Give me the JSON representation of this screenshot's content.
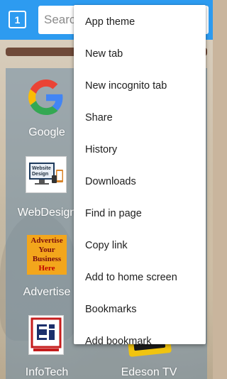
{
  "toolbar": {
    "tab_count": "1",
    "search_placeholder": "Search"
  },
  "shortcuts": [
    {
      "label": "Google"
    },
    {
      "label": "WebDesign"
    },
    {
      "label": "Advertise"
    },
    {
      "label": "InfoTech"
    },
    {
      "label": "Edeson TV"
    }
  ],
  "webdesign_thumb": {
    "text_line1": "Website",
    "text_line2": "Design"
  },
  "advertise_thumb": {
    "line1": "Advertise",
    "line2": "Your",
    "line3": "Business",
    "line4": "Here"
  },
  "menu": {
    "items": [
      {
        "label": "App theme"
      },
      {
        "label": "New tab"
      },
      {
        "label": "New incognito tab"
      },
      {
        "label": "Share"
      },
      {
        "label": "History"
      },
      {
        "label": "Downloads"
      },
      {
        "label": "Find in page"
      },
      {
        "label": "Copy link"
      },
      {
        "label": "Add to home screen"
      },
      {
        "label": "Bookmarks"
      },
      {
        "label": "Add bookmark"
      }
    ]
  },
  "colors": {
    "toolbar": "#2d9bf0",
    "google_blue": "#4285F4",
    "google_red": "#EA4335",
    "google_yellow": "#FBBC05",
    "google_green": "#34A853"
  }
}
